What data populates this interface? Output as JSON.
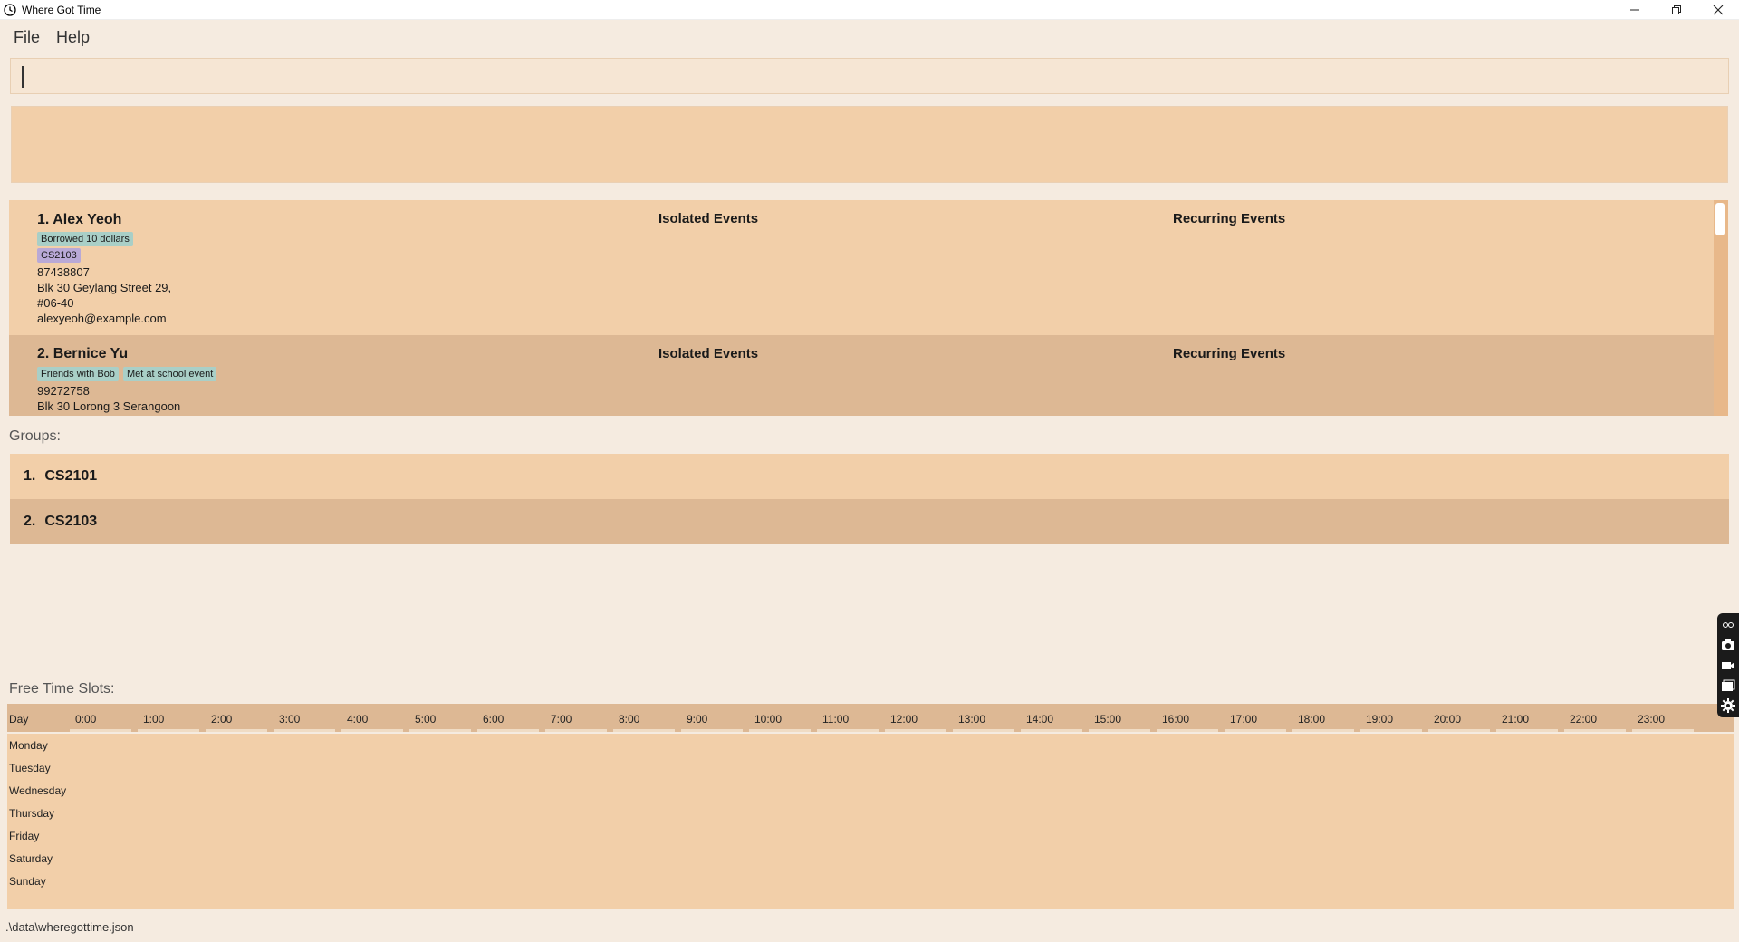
{
  "window": {
    "title": "Where Got Time",
    "minimize": "—",
    "restore": "❐",
    "close": "✕"
  },
  "menu": {
    "file": "File",
    "help": "Help"
  },
  "command_box": {
    "value": "",
    "placeholder": ""
  },
  "result_display": {
    "text": ""
  },
  "persons": [
    {
      "name": "1. Alex Yeoh",
      "tags": [
        "Borrowed 10 dollars"
      ],
      "groups": [
        "CS2103"
      ],
      "phone": "87438807",
      "address_line1": "Blk 30 Geylang Street 29,",
      "address_line2": "#06-40",
      "email": "alexyeoh@example.com",
      "isolated_label": "Isolated Events",
      "recurring_label": "Recurring Events"
    },
    {
      "name": "2. Bernice Yu",
      "tags": [
        "Friends with Bob",
        "Met at school event"
      ],
      "phone": "99272758",
      "address_line1": "Blk 30 Lorong 3 Serangoon",
      "isolated_label": "Isolated Events",
      "recurring_label": "Recurring Events"
    }
  ],
  "groups_label": "Groups:",
  "groups": [
    {
      "num": "1.",
      "name": "CS2101"
    },
    {
      "num": "2.",
      "name": "CS2103"
    }
  ],
  "free_time_label": "Free Time Slots:",
  "timetable": {
    "day_header": "Day",
    "hours": [
      "0:00",
      "1:00",
      "2:00",
      "3:00",
      "4:00",
      "5:00",
      "6:00",
      "7:00",
      "8:00",
      "9:00",
      "10:00",
      "11:00",
      "12:00",
      "13:00",
      "14:00",
      "15:00",
      "16:00",
      "17:00",
      "18:00",
      "19:00",
      "20:00",
      "21:00",
      "22:00",
      "23:00"
    ],
    "days": [
      "Monday",
      "Tuesday",
      "Wednesday",
      "Thursday",
      "Friday",
      "Saturday",
      "Sunday"
    ]
  },
  "status": {
    "file_path": ".\\data\\wheregottime.json"
  },
  "colors": {
    "background": "#f5ebe0",
    "card_light": "#f2cfa9",
    "card_dark": "#ddb894",
    "tag_teal": "#a9cfc7",
    "tag_purple": "#b9a9d6"
  },
  "icons": {
    "app": "clock-icon",
    "float_tools": [
      "link-icon",
      "camera-icon",
      "video-icon",
      "gallery-icon",
      "gear-icon"
    ]
  }
}
